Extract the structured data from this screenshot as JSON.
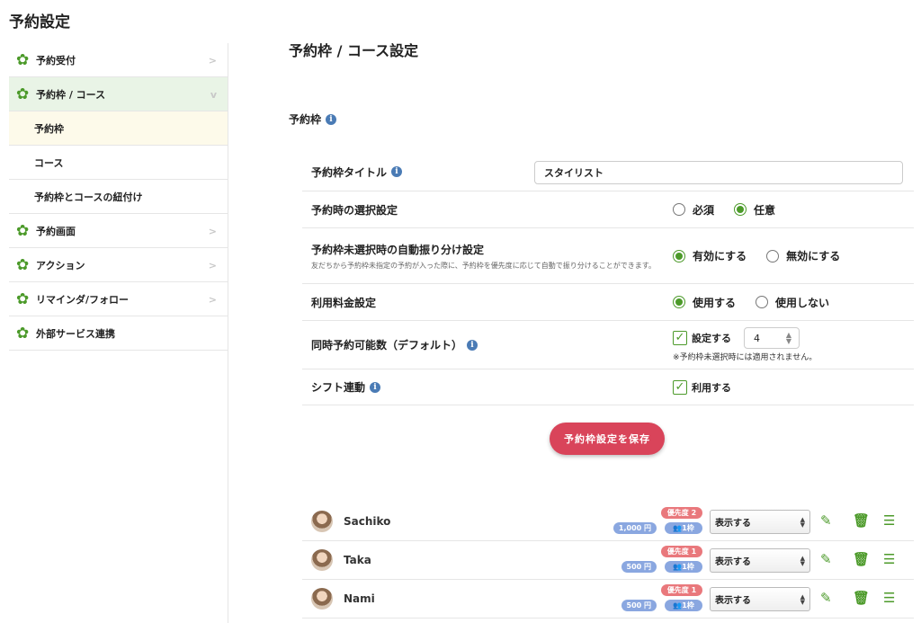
{
  "page_title": "予約設定",
  "sidebar": {
    "items": [
      {
        "label": "予約受付"
      },
      {
        "label": "予約枠 / コース"
      },
      {
        "label": "予約枠"
      },
      {
        "label": "コース"
      },
      {
        "label": "予約枠とコースの紐付け"
      },
      {
        "label": "予約画面"
      },
      {
        "label": "アクション"
      },
      {
        "label": "リマインダ/フォロー"
      },
      {
        "label": "外部サービス連携"
      }
    ]
  },
  "main": {
    "title": "予約枠 / コース設定",
    "section_title": "予約枠",
    "rows": {
      "title": {
        "label": "予約枠タイトル",
        "value": "スタイリスト"
      },
      "selection": {
        "label": "予約時の選択設定",
        "options": [
          "必須",
          "任意"
        ],
        "selected": "任意"
      },
      "auto": {
        "label": "予約枠未選択時の自動振り分け設定",
        "desc": "友だちから予約枠未指定の予約が入った際に、予約枠を優先度に応じて自動で振り分けることができます。",
        "options": [
          "有効にする",
          "無効にする"
        ],
        "selected": "有効にする"
      },
      "fee": {
        "label": "利用料金設定",
        "options": [
          "使用する",
          "使用しない"
        ],
        "selected": "使用する"
      },
      "concurrent": {
        "label": "同時予約可能数（デフォルト）",
        "check_label": "設定する",
        "value": "4",
        "note": "※予約枠未選択時には適用されません。"
      },
      "shift": {
        "label": "シフト連動",
        "check_label": "利用する"
      }
    },
    "save_label": "予約枠設定を保存"
  },
  "frames": [
    {
      "name": "Sachiko",
      "priority": "優先度 2",
      "price": "1,000 円",
      "count": "1枠",
      "visibility": "表示する"
    },
    {
      "name": "Taka",
      "priority": "優先度 1",
      "price": "500 円",
      "count": "1枠",
      "visibility": "表示する"
    },
    {
      "name": "Nami",
      "priority": "優先度 1",
      "price": "500 円",
      "count": "1枠",
      "visibility": "表示する"
    }
  ],
  "colors": {
    "accent": "#4c9a2a",
    "save": "#d9445a",
    "priority_badge": "#e9787c",
    "info_badge": "#8aa7e0"
  },
  "icons": {
    "gear": "gear-icon",
    "info": "info-icon",
    "edit": "edit-icon",
    "trash": "trash-icon",
    "menu": "drag-handle-icon"
  }
}
